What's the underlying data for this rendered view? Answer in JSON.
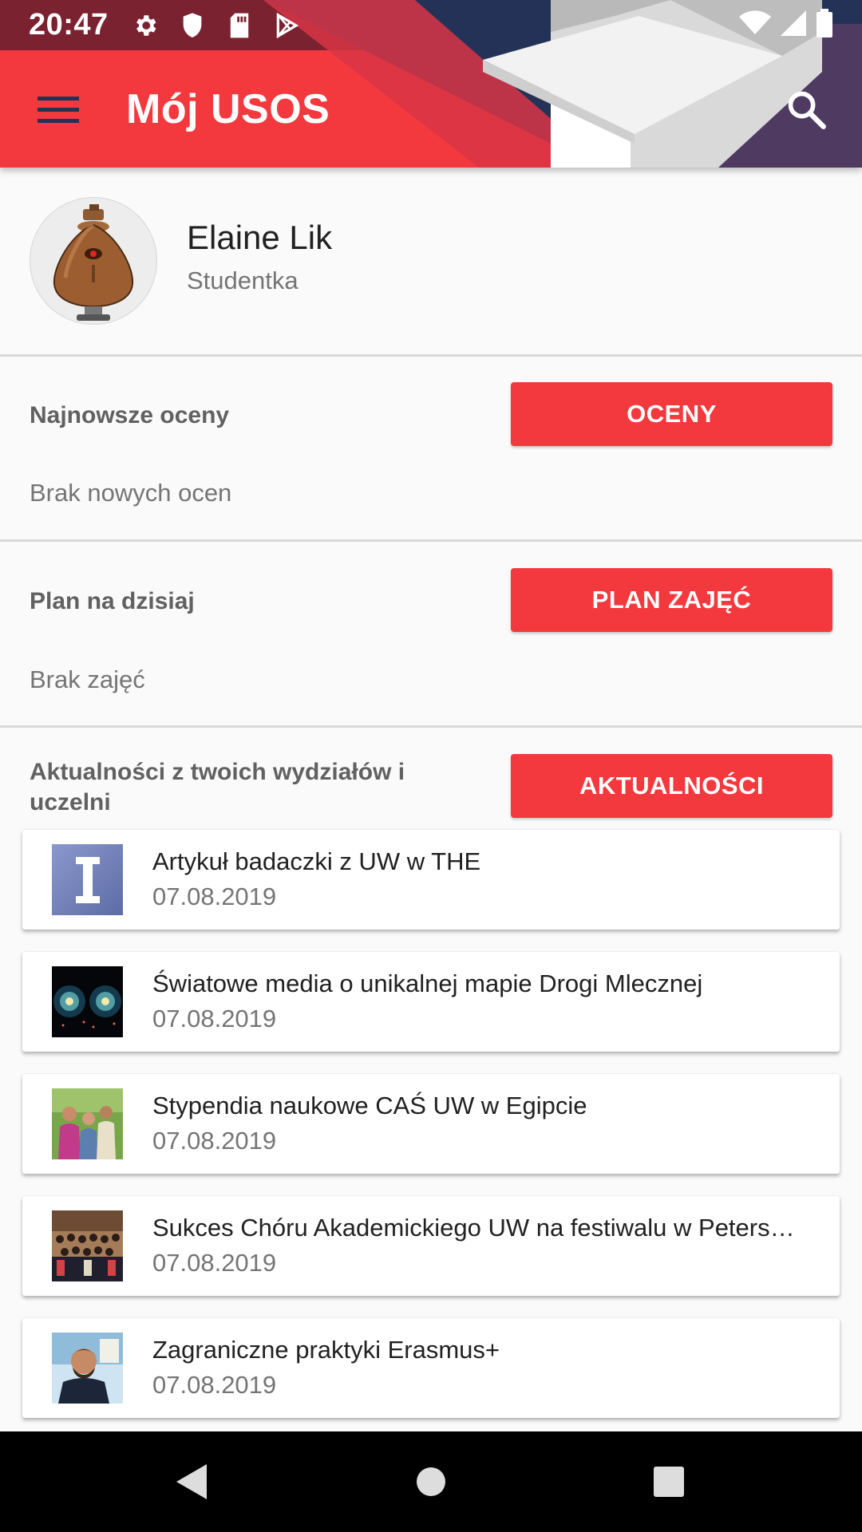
{
  "status_bar": {
    "time": "20:47",
    "left_icons": [
      "settings-icon",
      "shield-icon",
      "sd-card-icon",
      "play-store-icon"
    ],
    "right_icons": [
      "wifi-icon",
      "signal-icon",
      "battery-icon"
    ]
  },
  "app_bar": {
    "title": "Mój USOS",
    "menu_icon": "hamburger-menu-icon",
    "search_icon": "search-icon",
    "colors": {
      "primary": "#f3393e",
      "navy": "#253258",
      "purple": "#4f3a62"
    }
  },
  "profile": {
    "name": "Elaine Lik",
    "role": "Studentka"
  },
  "grades": {
    "label": "Najnowsze oceny",
    "button": "OCENY",
    "empty_text": "Brak nowych ocen"
  },
  "schedule": {
    "label": "Plan na dzisiaj",
    "button": "PLAN ZAJĘĆ",
    "empty_text": "Brak zajęć"
  },
  "news": {
    "label_line1": "Aktualności z twoich wydziałów i",
    "label_line2": "uczelni",
    "button": "AKTUALNOŚCI",
    "items": [
      {
        "title": "Artykuł badaczki z UW w THE",
        "date": "07.08.2019"
      },
      {
        "title": "Światowe media o unikalnej mapie Drogi Mlecznej",
        "date": "07.08.2019"
      },
      {
        "title": "Stypendia naukowe CAŚ UW w Egipcie",
        "date": "07.08.2019"
      },
      {
        "title": "Sukces Chóru Akademickiego UW na festiwalu w Petersburgu",
        "date": "07.08.2019"
      },
      {
        "title": "Zagraniczne praktyki Erasmus+",
        "date": "07.08.2019"
      }
    ]
  },
  "nav_bar": {
    "buttons": [
      "back-icon",
      "home-icon",
      "recents-icon"
    ]
  }
}
